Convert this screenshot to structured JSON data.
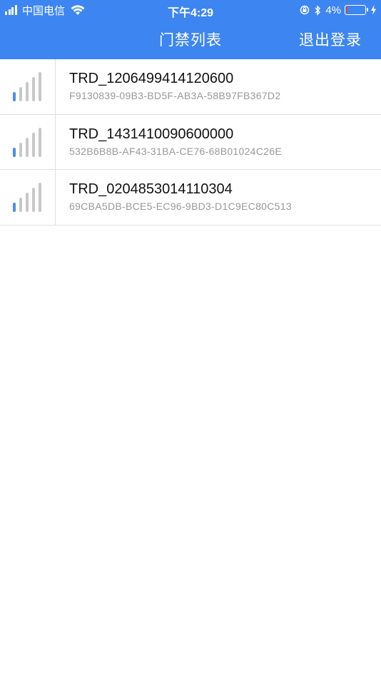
{
  "status_bar": {
    "carrier": "中国电信",
    "time": "下午4:29",
    "battery_percent": "4%",
    "signal_bars": 4,
    "battery_level": 0.04
  },
  "nav": {
    "title": "门禁列表",
    "logout_label": "退出登录",
    "background_color": "#3d86f1"
  },
  "devices": [
    {
      "name": "TRD_1206499414120600",
      "uuid": "F9130839-09B3-BD5F-AB3A-58B97FB367D2",
      "signal_strength": 1,
      "signal_icon": "signal-strength-icon"
    },
    {
      "name": "TRD_1431410090600000",
      "uuid": "532B6B8B-AF43-31BA-CE76-68B01024C26E",
      "signal_strength": 1,
      "signal_icon": "signal-strength-icon"
    },
    {
      "name": "TRD_0204853014110304",
      "uuid": "69CBA5DB-BCE5-EC96-9BD3-D1C9EC80C513",
      "signal_strength": 1,
      "signal_icon": "signal-strength-icon"
    }
  ],
  "colors": {
    "signal_active": "#4a8ff0",
    "signal_inactive": "#c8c8c8"
  }
}
